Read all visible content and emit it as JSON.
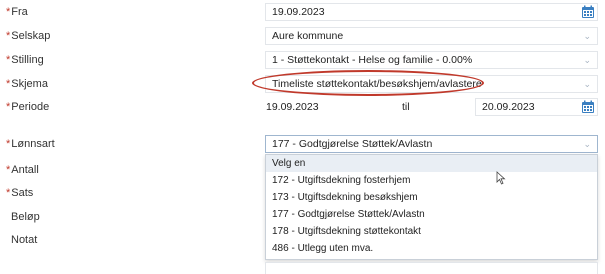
{
  "form": {
    "fra": {
      "label": "Fra",
      "required": "*",
      "value": "19.09.2023"
    },
    "selskap": {
      "label": "Selskap",
      "required": "*",
      "value": "Aure kommune"
    },
    "stilling": {
      "label": "Stilling",
      "required": "*",
      "value": "1 - Støttekontakt - Helse og familie - 0.00%"
    },
    "skjema": {
      "label": "Skjema",
      "required": "*",
      "value": "Timeliste støttekontakt/besøkshjem/avlastere"
    },
    "periode": {
      "label": "Periode",
      "required": "*",
      "from": "19.09.2023",
      "til_label": "til",
      "to": "20.09.2023"
    },
    "lonnsart": {
      "label": "Lønnsart",
      "required": "*",
      "value": "177 - Godtgjørelse Støttek/Avlastn"
    },
    "antall": {
      "label": "Antall",
      "required": "*"
    },
    "sats": {
      "label": "Sats",
      "required": "*"
    },
    "belop": {
      "label": "Beløp"
    },
    "notat": {
      "label": "Notat"
    }
  },
  "dropdown": {
    "options": [
      "Velg en",
      "172 - Utgiftsdekning fosterhjem",
      "173 - Utgiftsdekning besøkshjem",
      "177 - Godtgjørelse Støttek/Avlastn",
      "178 - Utgiftsdekning støttekontakt",
      "486 - Utlegg uten mva."
    ]
  },
  "colors": {
    "required": "#c0392b",
    "highlight_oval": "#c0392b",
    "calendar_icon": "#3a7fc1"
  },
  "icons": {
    "calendar": "calendar-icon",
    "chevron": "chevron-down-icon",
    "cursor": "mouse-cursor-icon"
  }
}
